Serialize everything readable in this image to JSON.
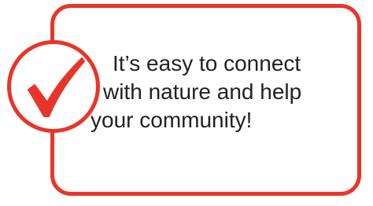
{
  "message": {
    "lines": [
      "It’s easy to connect",
      "with nature and help",
      "your community!"
    ]
  },
  "colors": {
    "accent": "#e8352b",
    "text": "#222222",
    "background": "#ffffff"
  },
  "icons": {
    "badge": "checkmark-icon"
  }
}
